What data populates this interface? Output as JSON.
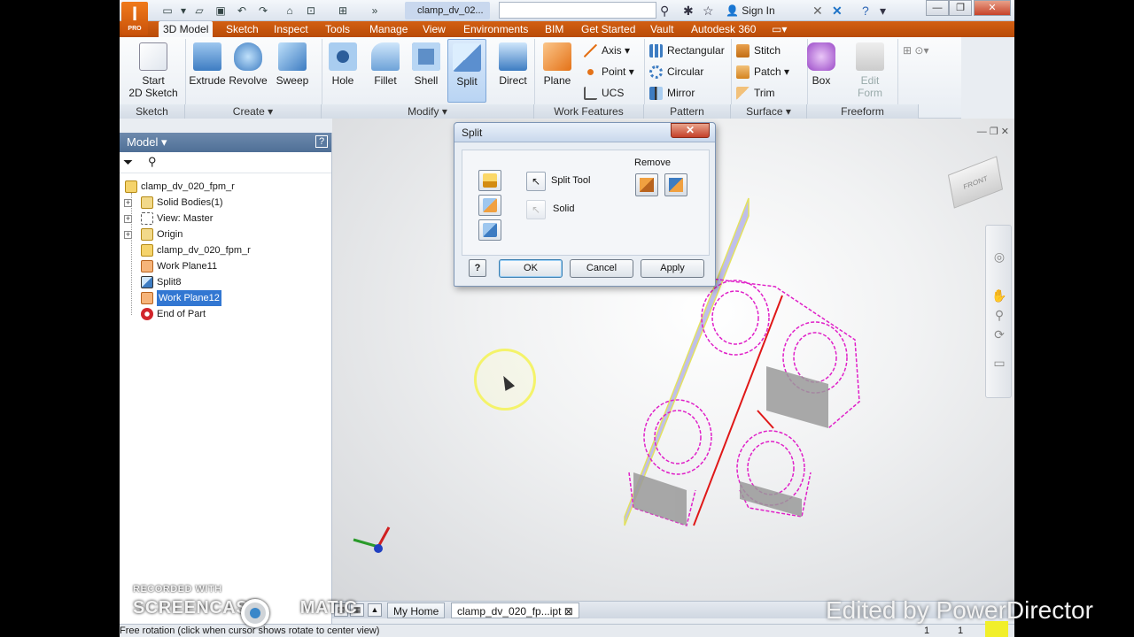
{
  "app": {
    "logo_letter": "I",
    "logo_sub": "PRO",
    "doc_title": "clamp_dv_02...",
    "signin_label": "Sign In",
    "search_placeholder": ""
  },
  "tabs": [
    "3D Model",
    "Sketch",
    "Inspect",
    "Tools",
    "Manage",
    "View",
    "Environments",
    "BIM",
    "Get Started",
    "Vault",
    "Autodesk 360"
  ],
  "active_tab": "3D Model",
  "ribbon": {
    "sketch": {
      "button": "Start\n2D Sketch",
      "line1": "Start",
      "line2": "2D Sketch",
      "group": "Sketch"
    },
    "create": {
      "buttons": [
        "Extrude",
        "Revolve",
        "Sweep"
      ],
      "group": "Create"
    },
    "modify": {
      "buttons": [
        "Hole",
        "Fillet",
        "Shell",
        "Split",
        "Direct"
      ],
      "group": "Modify"
    },
    "work_features": {
      "plane": "Plane",
      "small": [
        "Axis",
        "Point",
        "UCS"
      ],
      "group": "Work Features"
    },
    "pattern": {
      "small": [
        "Rectangular",
        "Circular",
        "Mirror"
      ],
      "group": "Pattern"
    },
    "surface": {
      "small": [
        "Stitch",
        "Patch",
        "Trim"
      ],
      "group": "Surface"
    },
    "freeform": {
      "buttons": [
        "Box",
        "Edit\nForm"
      ],
      "box": "Box",
      "edit1": "Edit",
      "edit2": "Form",
      "group": "Freeform"
    }
  },
  "browser": {
    "title": "Model",
    "help": "?",
    "items": [
      {
        "label": "clamp_dv_020_fpm_r",
        "type": "part"
      },
      {
        "label": "Solid Bodies(1)",
        "type": "folder"
      },
      {
        "label": "View: Master",
        "type": "view"
      },
      {
        "label": "Origin",
        "type": "folder"
      },
      {
        "label": "clamp_dv_020_fpm_r",
        "type": "part"
      },
      {
        "label": "Work Plane11",
        "type": "plane"
      },
      {
        "label": "Split8",
        "type": "feature"
      },
      {
        "label": "Work Plane12",
        "type": "plane",
        "selected": true
      },
      {
        "label": "End of Part",
        "type": "end"
      }
    ]
  },
  "dialog": {
    "title": "Split",
    "close": "✕",
    "split_tool_label": "Split Tool",
    "solid_label": "Solid",
    "remove_label": "Remove",
    "ok": "OK",
    "cancel": "Cancel",
    "apply": "Apply",
    "help": "?"
  },
  "viewcube_label": "FRONT",
  "doctabs": [
    "My Home",
    "clamp_dv_020_fp...ipt"
  ],
  "status": {
    "text": "Free rotation (click when cursor shows rotate to center view)",
    "num1": "1",
    "num2": "1"
  },
  "overlays": {
    "recorded": "RECORDED WITH",
    "screencast": "SCREENCAST",
    "matic": "MATIC",
    "watermark": "Edited by PowerDirector"
  },
  "colors": {
    "ribbon_tab": "#c5560d",
    "selection": "#3277d2",
    "magenta_geometry": "#e020c8",
    "split_plane": "#b9b8ea"
  }
}
